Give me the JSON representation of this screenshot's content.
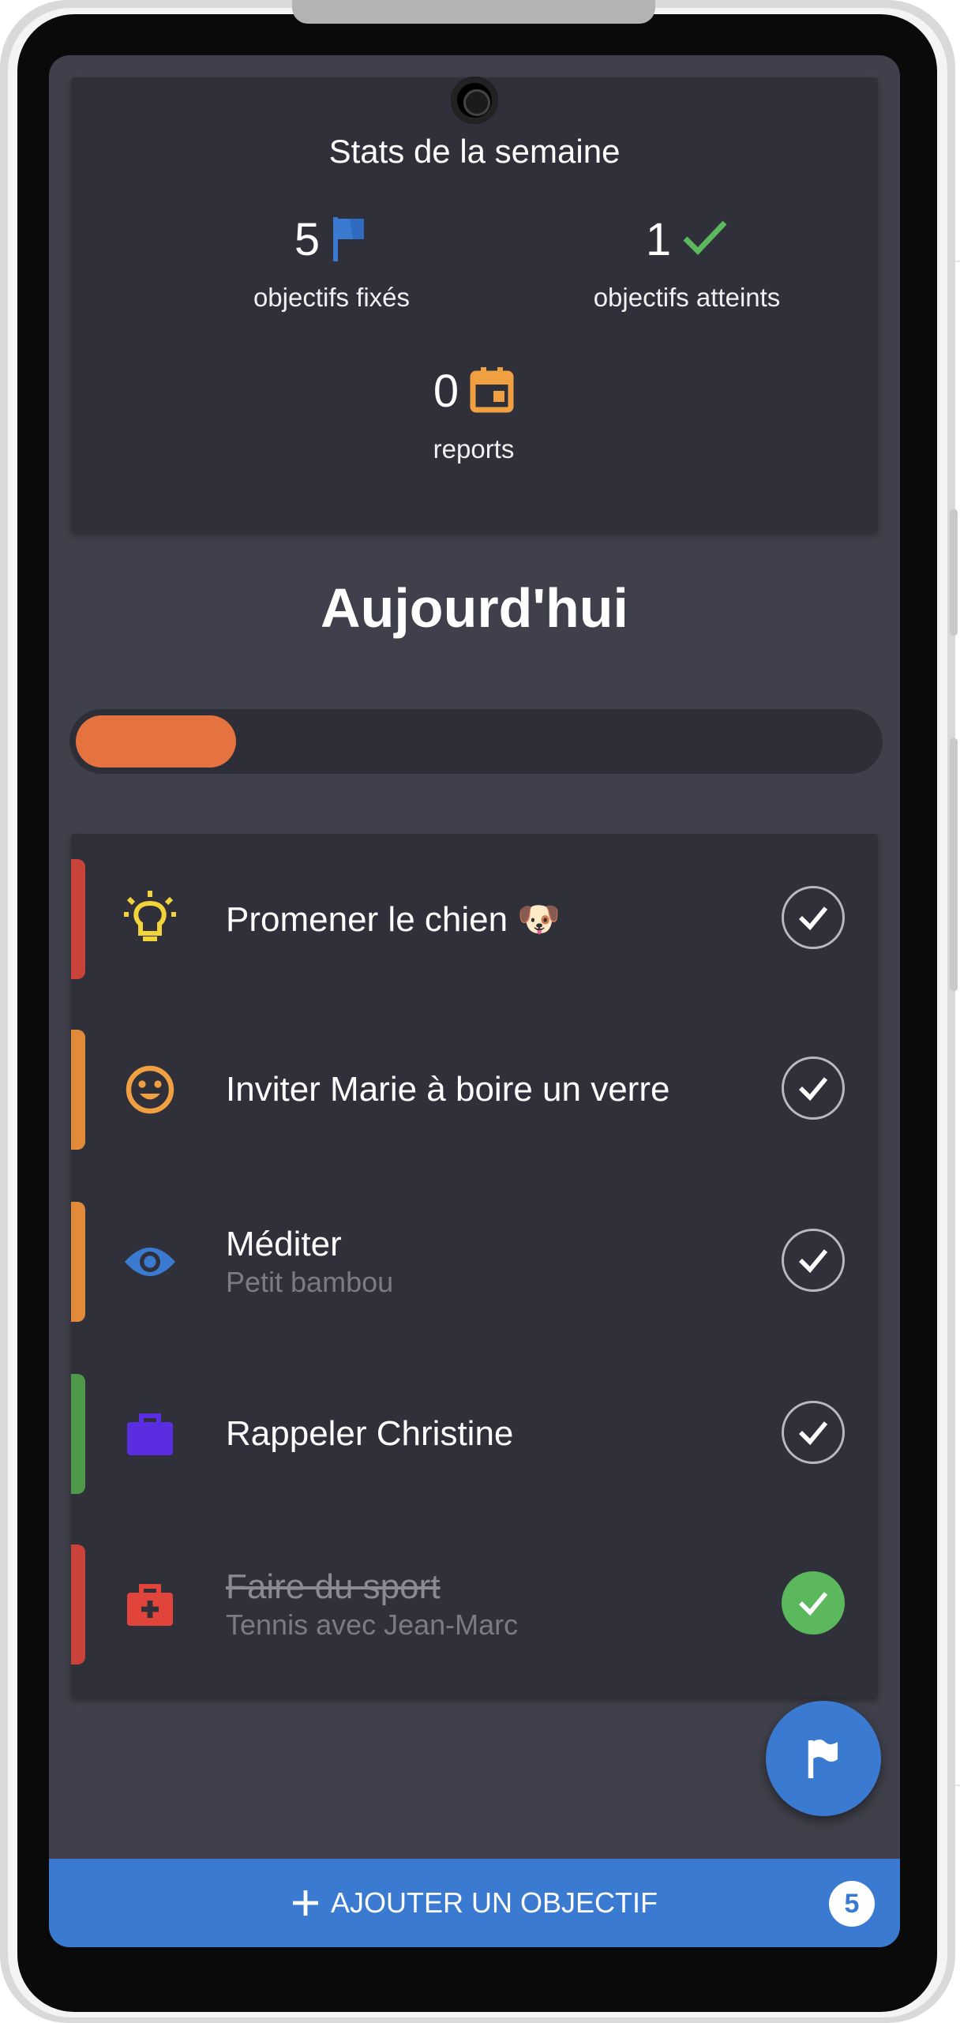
{
  "stats": {
    "title": "Stats de la semaine",
    "set": {
      "value": "5",
      "label": "objectifs fixés",
      "icon": "flag-icon",
      "color": "#3a7bd1"
    },
    "reached": {
      "value": "1",
      "label": "objectifs atteints",
      "icon": "check-icon",
      "color": "#5cb85c"
    },
    "postponed": {
      "value": "0",
      "label": "reports",
      "icon": "calendar-icon",
      "color": "#f0a040"
    }
  },
  "today": {
    "title": "Aujourd'hui",
    "progress": 0.2
  },
  "objectives": [
    {
      "title": "Promener le chien 🐶",
      "subtitle": "",
      "icon": "lightbulb-icon",
      "icon_color": "#f2d33a",
      "bar_color": "#c9433a",
      "done": false
    },
    {
      "title": "Inviter Marie à boire un verre",
      "subtitle": "",
      "icon": "smiley-icon",
      "icon_color": "#f0a040",
      "bar_color": "#e08a3a",
      "done": false
    },
    {
      "title": "Méditer",
      "subtitle": "Petit bambou",
      "icon": "eye-icon",
      "icon_color": "#3a7bd1",
      "bar_color": "#e08a3a",
      "done": false
    },
    {
      "title": "Rappeler Christine",
      "subtitle": "",
      "icon": "briefcase-icon",
      "icon_color": "#5a2de0",
      "bar_color": "#4f9a4a",
      "done": false
    },
    {
      "title": "Faire du sport",
      "subtitle": "Tennis avec Jean-Marc",
      "icon": "medkit-icon",
      "icon_color": "#e0443a",
      "bar_color": "#c9433a",
      "done": true
    }
  ],
  "fab": {
    "icon": "flag-icon"
  },
  "add_bar": {
    "label": "AJOUTER UN OBJECTIF",
    "count": "5"
  }
}
